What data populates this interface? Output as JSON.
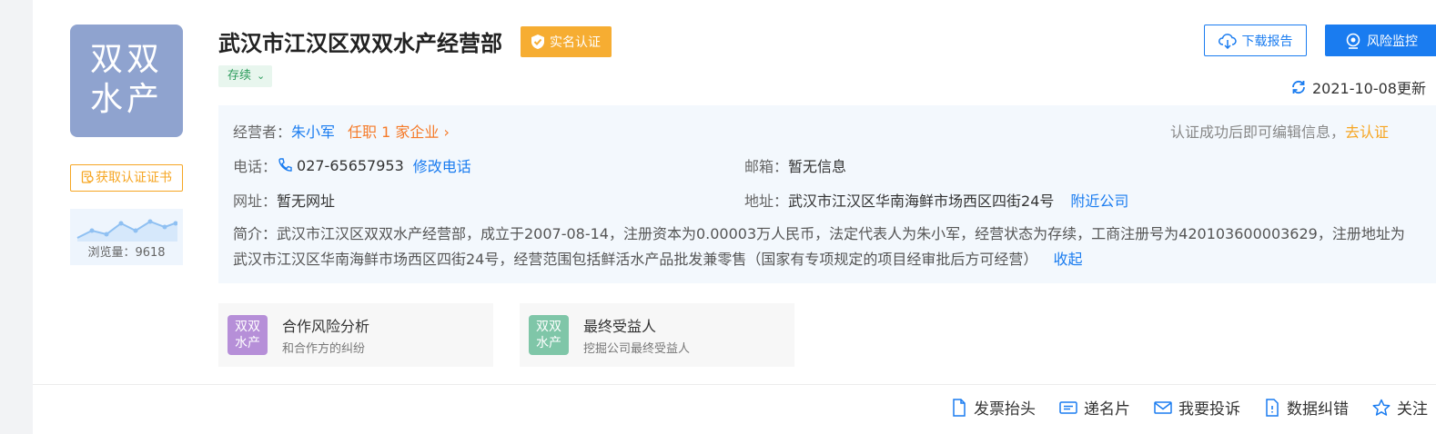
{
  "company": {
    "logo_line1": "双双",
    "logo_line2": "水产",
    "name": "武汉市江汉区双双水产经营部",
    "verified_label": "实名认证",
    "status": "存续"
  },
  "sidebar": {
    "cert_button": "获取认证证书",
    "views_label": "浏览量：9618"
  },
  "actions": {
    "download": "下载报告",
    "monitor": "风险监控",
    "updated": "2021-10-08更新"
  },
  "info": {
    "operator_label": "经营者：",
    "operator_name": "朱小军",
    "operator_positions": "任职 1 家企业",
    "edit_hint": "认证成功后即可编辑信息，",
    "edit_link": "去认证",
    "phone_label": "电话：",
    "phone_value": "027-65657953",
    "phone_edit": "修改电话",
    "email_label": "邮箱：",
    "email_value": "暂无信息",
    "website_label": "网址：",
    "website_value": "暂无网址",
    "address_label": "地址：",
    "address_value": "武汉市江汉区华南海鲜市场西区四街24号",
    "nearby_link": "附近公司",
    "desc_text": "简介：武汉市江汉区双双水产经营部，成立于2007-08-14，注册资本为0.00003万人民币，法定代表人为朱小军，经营状态为存续，工商注册号为420103600003629，注册地址为武汉市江汉区华南海鲜市场西区四街24号，经营范围包括鲜活水产品批发兼零售（国家有专项规定的项目经审批后方可经营）",
    "collapse_link": "收起"
  },
  "cards": [
    {
      "logo1": "双双",
      "logo2": "水产",
      "title": "合作风险分析",
      "subtitle": "和合作方的纠纷",
      "color": "#b68fd8"
    },
    {
      "logo1": "双双",
      "logo2": "水产",
      "title": "最终受益人",
      "subtitle": "挖掘公司最终受益人",
      "color": "#7fc6a8"
    }
  ],
  "footer": {
    "invoice": "发票抬头",
    "card": "递名片",
    "complain": "我要投诉",
    "correct": "数据纠错",
    "follow": "关注"
  },
  "colors": {
    "accent": "#1a7cf0",
    "verified": "#f6ad32",
    "logo_bg": "#8fa3cf",
    "status_green": "#2b9b5b"
  }
}
